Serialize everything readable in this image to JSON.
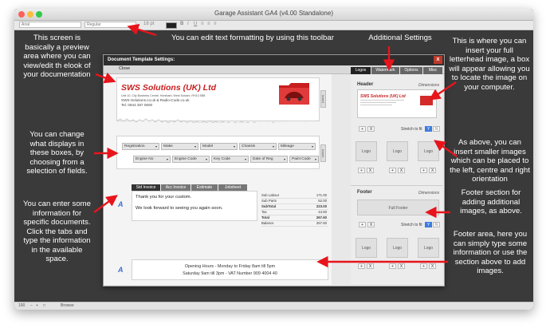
{
  "window": {
    "title": "Garage Assistant GA4 (v4.00 Standalone)"
  },
  "format_toolbar": {
    "font": "Arial",
    "style": "Regular",
    "size": "18 pt",
    "bold": "B",
    "italic": "I",
    "underline": "U"
  },
  "statusbar": {
    "zoom": "100",
    "mode": "Browse"
  },
  "dialog": {
    "title": "Document Template Settings:",
    "close_label": "Close",
    "close_x": "x",
    "letterhead": {
      "company": "SWS Solutions (UK) Ltd",
      "address": "Unit 10, City Business Centre, Horsham, West Sussex, RH13 5BB",
      "web": "SWS-Solutions.co.uk & Radio-Code.co.uk",
      "tel": "Tel. 0844 357 0600",
      "insert_tab": "Insert"
    },
    "fields": {
      "row1": [
        "Registration",
        "Make",
        "Model",
        "Chassis",
        "Mileage"
      ],
      "row2": [
        "Engine No",
        "Engine Code",
        "Key Code",
        "Date of Reg",
        "Paint Code"
      ],
      "insert_tab": "Insert"
    },
    "doc_tabs": [
      "Std Invoice",
      "Acc Invoice",
      "Estimate",
      "Jobsheet"
    ],
    "custom_text": [
      "Thank you for your custom.",
      "We look forward to seeing you again soon."
    ],
    "totals": [
      {
        "label": "Sub Labour",
        "value": "171.00"
      },
      {
        "label": "Sub Parts",
        "value": "52.00"
      },
      {
        "label": "SubTotal",
        "value": "223.00"
      },
      {
        "label": "Tax",
        "value": "44.60"
      },
      {
        "label": "Total",
        "value": "267.60"
      },
      {
        "label": "Balance",
        "value": "267.60"
      }
    ],
    "footer_text": [
      "Opening Hours - Monday to Friday 8am till 5pm",
      "Saturday 9am till 3pm - VAT Number 909 4004 40"
    ],
    "side_tabs": [
      "Logos",
      "Watermark",
      "Options",
      "Misc"
    ],
    "header_label": "Header",
    "dimensions_label": "Dimensions",
    "stretch_label": "Stretch to fit",
    "logo_label": "Logo",
    "footer_label": "Footer",
    "full_footer_label": "Full Footer",
    "plus": "+",
    "x_btn": "X",
    "y_btn": "Y",
    "n_btn": "N",
    "text_icon": "A"
  },
  "annotations": {
    "toolbar": "You can edit text formatting  by using this toolbar",
    "preview": "This screen is basically a preview area where you can view/edit th elook of your documentation",
    "additional": "Additional Settings",
    "letterhead": "This is where you can insert your full letterhead image, a box will appear allowing you to locate the image on your computer.",
    "fields": "You can change what displays in these boxes, by choosing from a selection of fields.",
    "smaller": "As above, you can insert smaller images which can be placed to the left, centre and right orientation",
    "enter_info": "You can enter some information for specific documents.  Click the tabs and type the information in the available space.",
    "footer_section": "Footer section for adding additional images, as above.",
    "footer_area": "Footer area, here you can simply type some information or use the section above to add images."
  },
  "colors": {
    "dark_bg": "#3a3a3a",
    "arrow": "#e8141c",
    "company_red": "#c81e1e",
    "toggle_blue": "#3d7ce0"
  }
}
